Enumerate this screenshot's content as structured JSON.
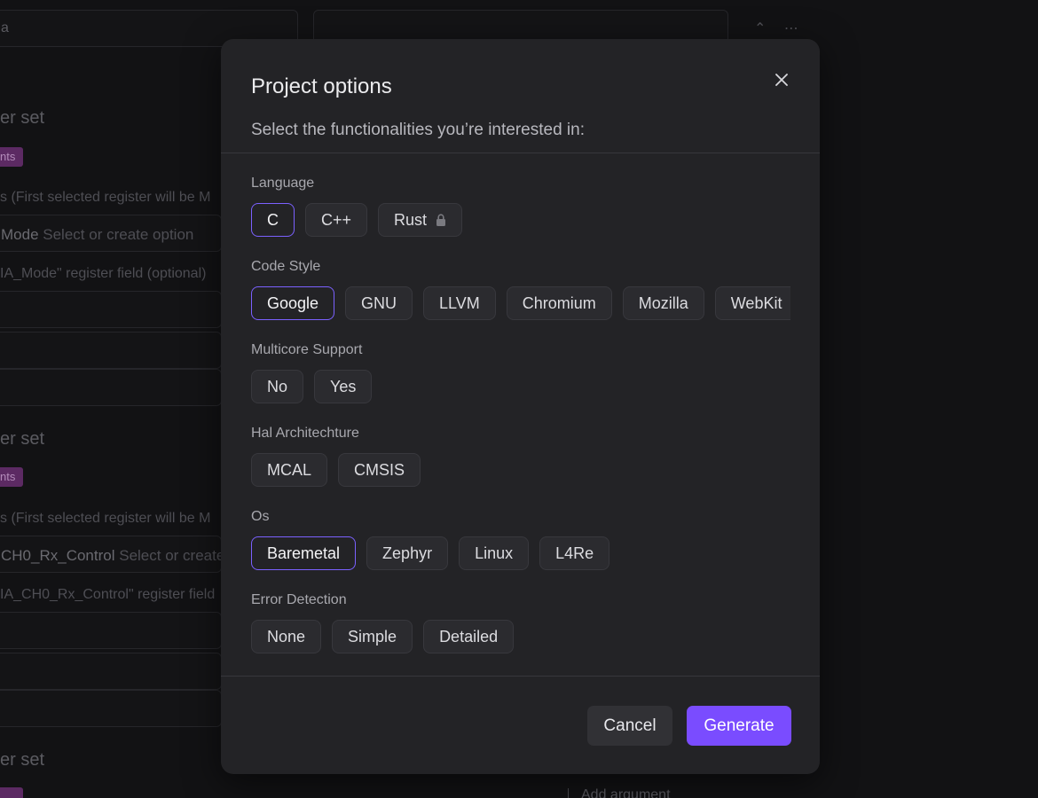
{
  "background": {
    "top_left_value": "a",
    "heading_1": "er set",
    "badge_1": "nts",
    "hint_1": "s (First selected register will be M",
    "mode_field_1": {
      "prefix": "Mode",
      "placeholder": "Select or create option"
    },
    "field_hint_1": "IA_Mode\" register field (optional)",
    "heading_2": "er set",
    "badge_2": "nts",
    "hint_2": "s (First selected register will be M",
    "mode_field_2": {
      "prefix": "CH0_Rx_Control",
      "placeholder": "Select or create"
    },
    "field_hint_2": "IA_CH0_Rx_Control\" register field",
    "heading_3": "er set",
    "add_argument": "Add argument"
  },
  "modal": {
    "title": "Project options",
    "subtitle": "Select the functionalities you’re interested in:",
    "sections": [
      {
        "label": "Language",
        "options": [
          "C",
          "C++",
          "Rust"
        ],
        "selected": "C",
        "locked": [
          "Rust"
        ]
      },
      {
        "label": "Code Style",
        "options": [
          "Google",
          "GNU",
          "LLVM",
          "Chromium",
          "Mozilla",
          "WebKit"
        ],
        "selected": "Google"
      },
      {
        "label": "Multicore Support",
        "options": [
          "No",
          "Yes"
        ],
        "selected": ""
      },
      {
        "label": "Hal Architechture",
        "options": [
          "MCAL",
          "CMSIS"
        ],
        "selected": ""
      },
      {
        "label": "Os",
        "options": [
          "Baremetal",
          "Zephyr",
          "Linux",
          "L4Re"
        ],
        "selected": "Baremetal"
      },
      {
        "label": "Error Detection",
        "options": [
          "None",
          "Simple",
          "Detailed"
        ],
        "selected": ""
      }
    ],
    "cancel_label": "Cancel",
    "generate_label": "Generate",
    "icons": {
      "close": "close-icon",
      "lock": "lock-icon"
    }
  },
  "colors": {
    "accent": "#7b61ff",
    "primary_button": "#7a4cff",
    "modal_bg": "#232326",
    "page_bg": "#121214"
  }
}
